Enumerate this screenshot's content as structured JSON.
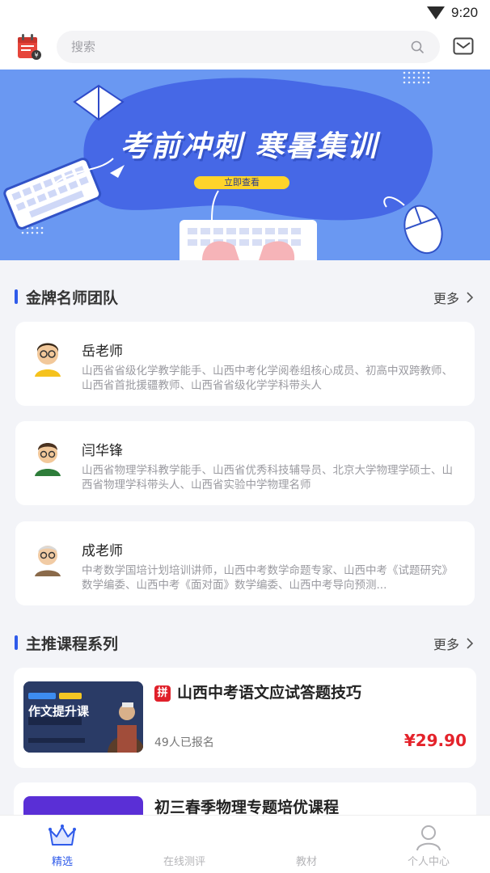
{
  "status_bar": {
    "time": "9:20"
  },
  "header": {
    "search_placeholder": "搜索",
    "app_icon": "calendar-icon",
    "mail_icon": "mail-icon"
  },
  "banner": {
    "title": "考前冲刺  寒暑集训",
    "button_label": "立即查看"
  },
  "teachers_section": {
    "title": "金牌名师团队",
    "more_label": "更多",
    "items": [
      {
        "name": "岳老师",
        "desc": "山西省省级化学教学能手、山西中考化学阅卷组核心成员、初高中双跨教师、山西省首批援疆教师、山西省省级化学学科带头人"
      },
      {
        "name": "闫华锋",
        "desc": "山西省物理学科教学能手、山西省优秀科技辅导员、北京大学物理学硕士、山西省物理学科带头人、山西省实验中学物理名师"
      },
      {
        "name": "成老师",
        "desc": "中考数学国培计划培训讲师，山西中考数学命题专家、山西中考《试题研究》数学编委、山西中考《面对面》数学编委、山西中考导向预测..."
      }
    ]
  },
  "courses_section": {
    "title": "主推课程系列",
    "more_label": "更多",
    "items": [
      {
        "tag": "拼",
        "title": "山西中考语文应试答题技巧",
        "enrolled": "49人已报名",
        "price": "¥29.90",
        "thumb_text": "作文提升课"
      },
      {
        "tag": "",
        "title": "初三春季物理专题培优课程",
        "enrolled": "",
        "price": ""
      }
    ]
  },
  "bottom_nav": {
    "items": [
      {
        "label": "精选",
        "icon": "crown-icon",
        "active": true
      },
      {
        "label": "在线测评",
        "icon": "test-icon",
        "active": false
      },
      {
        "label": "教材",
        "icon": "book-icon",
        "active": false
      },
      {
        "label": "个人中心",
        "icon": "user-icon",
        "active": false
      }
    ]
  },
  "colors": {
    "accent": "#2f5bea",
    "price": "#e4232b",
    "banner_bg": "#6a98f2",
    "banner_button": "#ffd42a"
  }
}
